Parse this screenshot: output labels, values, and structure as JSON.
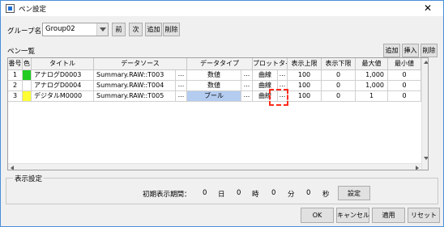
{
  "window": {
    "title": "ペン設定",
    "close_glyph": "✕"
  },
  "group_name": {
    "label": "グループ名",
    "value": "Group02"
  },
  "toolbar": {
    "prev": "前",
    "next": "次",
    "add": "追加",
    "delete": "削除"
  },
  "pen_list": {
    "label": "ペン一覧",
    "add": "追加",
    "insert": "挿入",
    "delete": "削除",
    "columns": [
      "番号",
      "色",
      "タイトル",
      "データソース",
      "データタイプ",
      "プロットタイプ",
      "表示上限",
      "表示下限",
      "最大値",
      "最小値"
    ],
    "rows": [
      {
        "no": "1",
        "color": "#22cc22",
        "title": "アナログD0003",
        "source": "Summary.RAW::T003",
        "dtype": "数値",
        "ptype": "曲線",
        "upper": "100",
        "lower": "0",
        "max": "1,000",
        "min": "0"
      },
      {
        "no": "2",
        "color": "#ffffff",
        "title": "アナログD0004",
        "source": "Summary.RAW::T004",
        "dtype": "数値",
        "ptype": "曲線",
        "upper": "100",
        "lower": "0",
        "max": "1,000",
        "min": "0"
      },
      {
        "no": "3",
        "color": "#ffff33",
        "title": "デジタルM0000",
        "source": "Summary.RAW::T005",
        "dtype": "ブール",
        "ptype": "曲線",
        "upper": "100",
        "lower": "0",
        "max": "1",
        "min": "0"
      }
    ],
    "ellipsis": "...",
    "selected_dtype_color": "#b4ccf0"
  },
  "display_settings": {
    "legend": "表示設定",
    "period_label": "初期表示期間：",
    "days": "0",
    "days_unit": "日",
    "hours": "0",
    "hours_unit": "時",
    "minutes": "0",
    "minutes_unit": "分",
    "seconds": "0",
    "seconds_unit": "秒",
    "settings_button": "設定"
  },
  "footer": {
    "ok": "OK",
    "cancel": "キャンセル",
    "apply": "適用",
    "reset": "リセット"
  },
  "colors": {
    "accent": "#4a90d9",
    "annotation": "#ff2a1a"
  }
}
